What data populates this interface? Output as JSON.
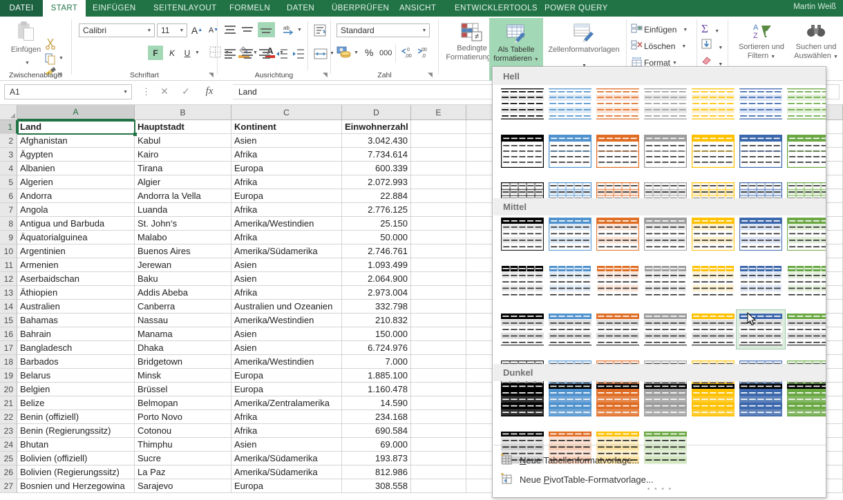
{
  "window": {
    "user": "Martin Weiß"
  },
  "tabs": [
    {
      "label": "DATEI",
      "active": false,
      "file": true
    },
    {
      "label": "START",
      "active": true
    },
    {
      "label": "EINFÜGEN",
      "active": false
    },
    {
      "label": "SEITENLAYOUT",
      "active": false
    },
    {
      "label": "FORMELN",
      "active": false
    },
    {
      "label": "DATEN",
      "active": false
    },
    {
      "label": "ÜBERPRÜFEN",
      "active": false
    },
    {
      "label": "ANSICHT",
      "active": false
    },
    {
      "label": "ENTWICKLERTOOLS",
      "active": false
    },
    {
      "label": "POWER QUERY",
      "active": false
    }
  ],
  "ribbon": {
    "groups": [
      {
        "name": "Zwischenablage",
        "label": "Zwischenablage"
      },
      {
        "name": "Schriftart",
        "label": "Schriftart"
      },
      {
        "name": "Ausrichtung",
        "label": "Ausrichtung"
      },
      {
        "name": "Zahl",
        "label": "Zahl"
      },
      {
        "name": "Formatvorlagen",
        "label": ""
      },
      {
        "name": "Zellen",
        "label": ""
      },
      {
        "name": "Bearbeiten",
        "label": ""
      }
    ],
    "clipboard": {
      "paste_label": "Einfügen"
    },
    "font": {
      "family": "Calibri",
      "size": "11",
      "bold": "F",
      "italic": "K",
      "underline": "U"
    },
    "number": {
      "format": "Standard",
      "percent": "%",
      "thousands": "000"
    },
    "styles": {
      "conditional_line1": "Bedingte",
      "conditional_line2": "Formatierung",
      "table_line1": "Als Tabelle",
      "table_line2": "formatieren",
      "cellstyles": "Zellenformatvorlagen"
    },
    "cells": {
      "insert": "Einfügen",
      "delete": "Löschen",
      "format": "Format"
    },
    "editing": {
      "sort_line1": "Sortieren und",
      "sort_line2": "Filtern",
      "find_line1": "Suchen und",
      "find_line2": "Auswählen"
    }
  },
  "formula_bar": {
    "name_box": "A1",
    "cancel_icon": "cancel-icon",
    "accept_icon": "accept-icon",
    "fx_icon": "fx",
    "value": "Land"
  },
  "grid": {
    "columns": [
      {
        "label": "A",
        "width": 170,
        "selected": true
      },
      {
        "label": "B",
        "width": 140,
        "selected": false
      },
      {
        "label": "C",
        "width": 160,
        "selected": false
      },
      {
        "label": "D",
        "width": 100,
        "selected": false
      },
      {
        "label": "E",
        "width": 80,
        "selected": false
      }
    ],
    "headers": [
      "Land",
      "Hauptstadt",
      "Kontinent",
      "Einwohnerzahl"
    ],
    "rows": [
      {
        "n": 2,
        "cells": [
          "Afghanistan",
          "Kabul",
          "Asien",
          "3.042.430"
        ]
      },
      {
        "n": 3,
        "cells": [
          "Ägypten",
          "Kairo",
          "Afrika",
          "7.734.614"
        ]
      },
      {
        "n": 4,
        "cells": [
          "Albanien",
          "Tirana",
          "Europa",
          "600.339"
        ]
      },
      {
        "n": 5,
        "cells": [
          "Algerien",
          "Algier",
          "Afrika",
          "2.072.993"
        ]
      },
      {
        "n": 6,
        "cells": [
          "Andorra",
          "Andorra la Vella",
          "Europa",
          "22.884"
        ]
      },
      {
        "n": 7,
        "cells": [
          "Angola",
          "Luanda",
          "Afrika",
          "2.776.125"
        ]
      },
      {
        "n": 8,
        "cells": [
          "Antigua und Barbuda",
          "St. John‘s",
          "Amerika/Westindien",
          "25.150"
        ]
      },
      {
        "n": 9,
        "cells": [
          "Äquatorialguinea",
          "Malabo",
          "Afrika",
          "50.000"
        ]
      },
      {
        "n": 10,
        "cells": [
          "Argentinien",
          "Buenos Aires",
          "Amerika/Südamerika",
          "2.746.761"
        ]
      },
      {
        "n": 11,
        "cells": [
          "Armenien",
          "Jerewan",
          "Asien",
          "1.093.499"
        ]
      },
      {
        "n": 12,
        "cells": [
          "Aserbaidschan",
          "Baku",
          "Asien",
          "2.064.900"
        ]
      },
      {
        "n": 13,
        "cells": [
          "Äthiopien",
          "Addis Abeba",
          "Afrika",
          "2.973.004"
        ]
      },
      {
        "n": 14,
        "cells": [
          "Australien",
          "Canberra",
          "Australien und Ozeanien",
          "332.798"
        ]
      },
      {
        "n": 15,
        "cells": [
          "Bahamas",
          "Nassau",
          "Amerika/Westindien",
          "210.832"
        ]
      },
      {
        "n": 16,
        "cells": [
          "Bahrain",
          "Manama",
          "Asien",
          "150.000"
        ]
      },
      {
        "n": 17,
        "cells": [
          "Bangladesch",
          "Dhaka",
          "Asien",
          "6.724.976"
        ]
      },
      {
        "n": 18,
        "cells": [
          "Barbados",
          "Bridgetown",
          "Amerika/Westindien",
          "7.000"
        ]
      },
      {
        "n": 19,
        "cells": [
          "Belarus",
          "Minsk",
          "Europa",
          "1.885.100"
        ]
      },
      {
        "n": 20,
        "cells": [
          "Belgien",
          "Brüssel",
          "Europa",
          "1.160.478"
        ]
      },
      {
        "n": 21,
        "cells": [
          "Belize",
          "Belmopan",
          "Amerika/Zentralamerika",
          "14.590"
        ]
      },
      {
        "n": 22,
        "cells": [
          "Benin (offiziell)",
          "Porto Novo",
          "Afrika",
          "234.168"
        ]
      },
      {
        "n": 23,
        "cells": [
          "Benin (Regierungssitz)",
          "Cotonou",
          "Afrika",
          "690.584"
        ]
      },
      {
        "n": 24,
        "cells": [
          "Bhutan",
          "Thimphu",
          "Asien",
          "69.000"
        ]
      },
      {
        "n": 25,
        "cells": [
          "Bolivien (offiziell)",
          "Sucre",
          "Amerika/Südamerika",
          "193.873"
        ]
      },
      {
        "n": 26,
        "cells": [
          "Bolivien (Regierungssitz)",
          "La Paz",
          "Amerika/Südamerika",
          "812.986"
        ]
      },
      {
        "n": 27,
        "cells": [
          "Bosnien und Herzegowina",
          "Sarajevo",
          "Europa",
          "308.558"
        ]
      }
    ],
    "selected_cell": "A1"
  },
  "gallery": {
    "sections": [
      {
        "title": "Hell",
        "rows": 3
      },
      {
        "title": "Mittel",
        "rows": 4
      },
      {
        "title": "Dunkel",
        "rows": 2
      }
    ],
    "hover_item": {
      "section": "Mittel",
      "row": 3,
      "col": 6
    },
    "footer_items": [
      {
        "accel": "N",
        "rest": "eue Tabellenformatvorlage...",
        "icon": "new-table-style-icon"
      },
      {
        "pre": "Neue ",
        "accel": "P",
        "rest": "ivotTable-Formatvorlage...",
        "icon": "new-pivot-style-icon"
      }
    ],
    "colors": {
      "black": "#000000",
      "blue": "#4e91cd",
      "orange": "#e06c23",
      "gray": "#9c9c9c",
      "yellow": "#ffc000",
      "darkblue": "#3a66ab",
      "green": "#68a741",
      "accent_hover": "#ddeede"
    }
  }
}
